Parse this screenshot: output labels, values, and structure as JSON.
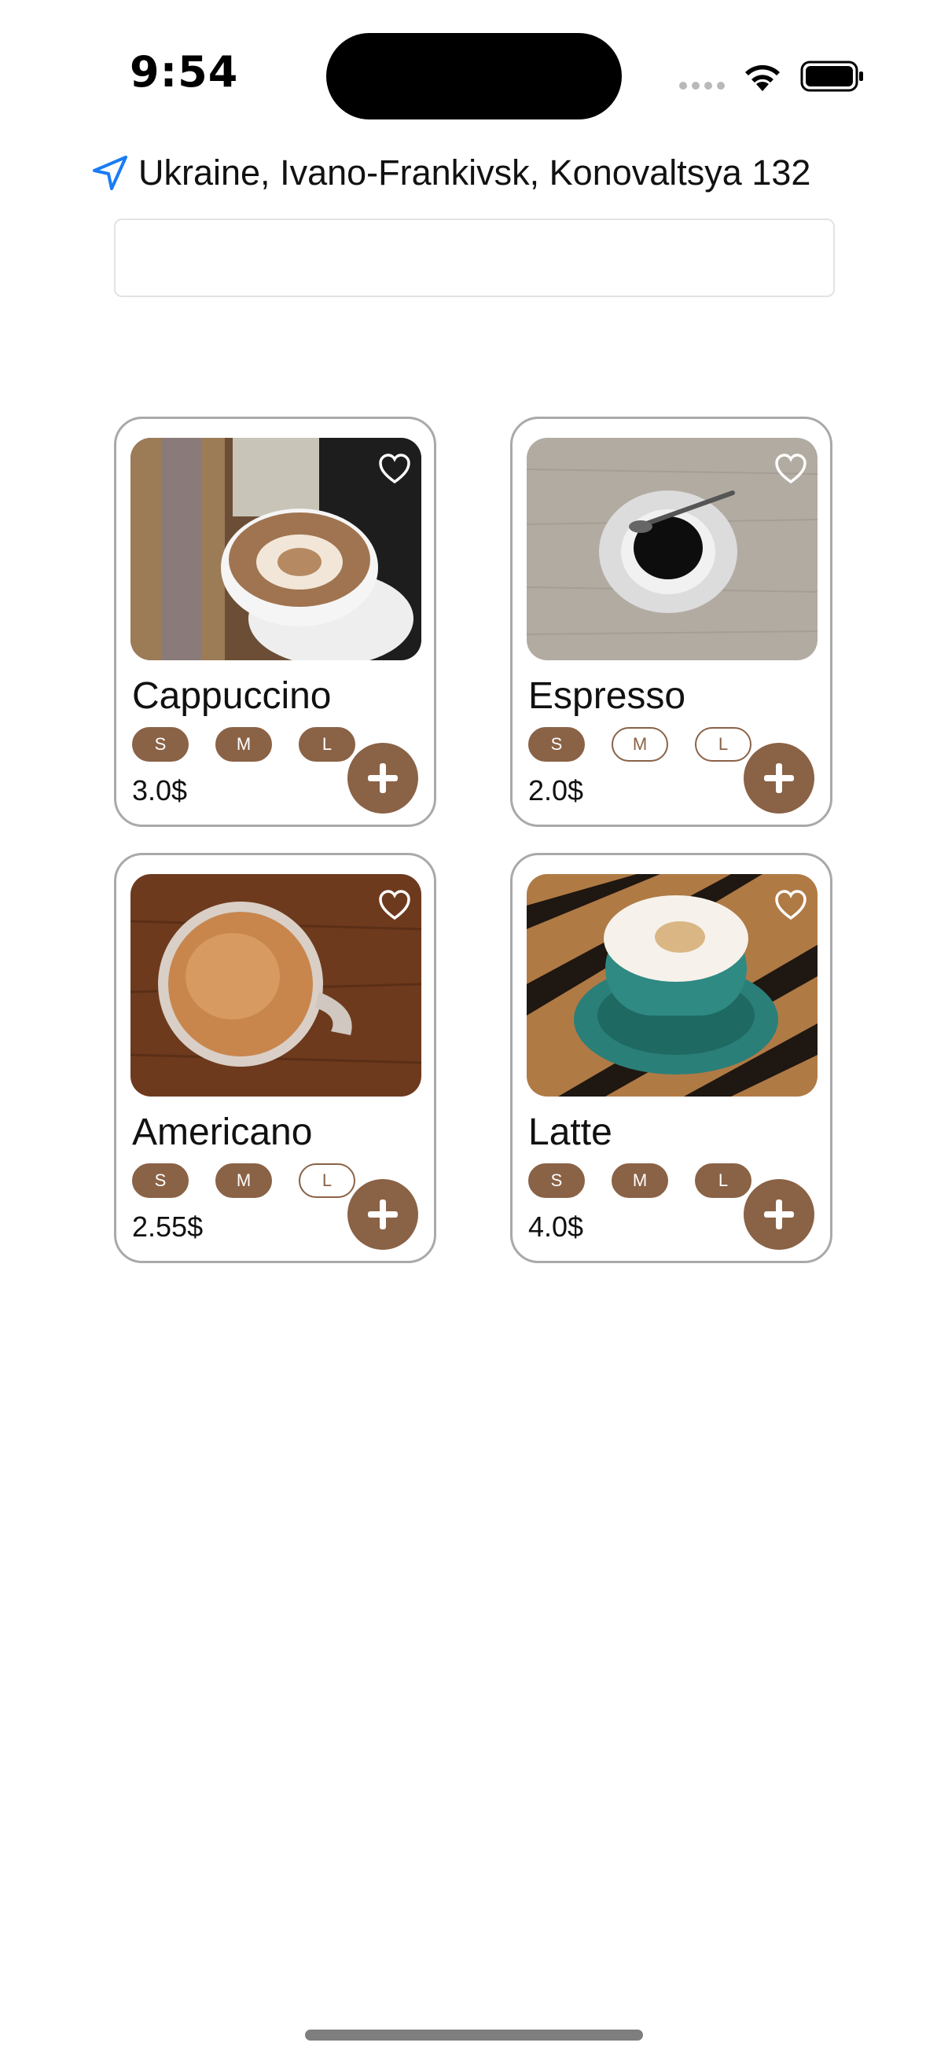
{
  "status_bar": {
    "time": "9:54"
  },
  "location": {
    "text": "Ukraine, Ivano-Frankivsk, Konovaltsya 132",
    "icon": "location-arrow-icon"
  },
  "search": {
    "value": "",
    "placeholder": ""
  },
  "accent_color": "#8a6246",
  "products": [
    {
      "name": "Cappuccino",
      "price": "3.0$",
      "sizes": [
        {
          "label": "S",
          "selected": true
        },
        {
          "label": "M",
          "selected": true
        },
        {
          "label": "L",
          "selected": true
        }
      ]
    },
    {
      "name": "Espresso",
      "price": "2.0$",
      "sizes": [
        {
          "label": "S",
          "selected": true
        },
        {
          "label": "M",
          "selected": false
        },
        {
          "label": "L",
          "selected": false
        }
      ]
    },
    {
      "name": "Americano",
      "price": "2.55$",
      "sizes": [
        {
          "label": "S",
          "selected": true
        },
        {
          "label": "M",
          "selected": true
        },
        {
          "label": "L",
          "selected": false
        }
      ]
    },
    {
      "name": "Latte",
      "price": "4.0$",
      "sizes": [
        {
          "label": "S",
          "selected": true
        },
        {
          "label": "M",
          "selected": true
        },
        {
          "label": "L",
          "selected": true
        }
      ]
    }
  ]
}
